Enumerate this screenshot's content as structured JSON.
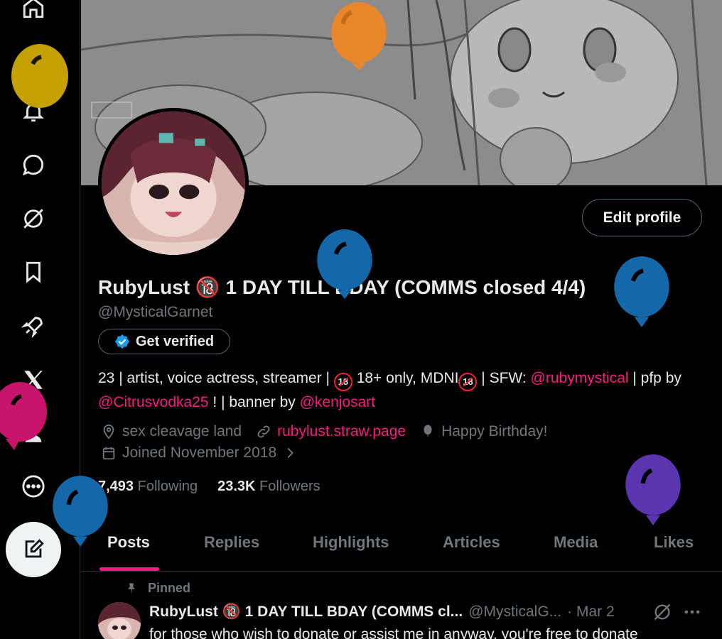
{
  "sidebar": {
    "items": [
      {
        "icon": "home-icon"
      },
      {
        "icon": "search-icon"
      },
      {
        "icon": "notifications-icon"
      },
      {
        "icon": "messages-icon"
      },
      {
        "icon": "grok-icon"
      },
      {
        "icon": "bookmarks-icon"
      },
      {
        "icon": "rocket-icon"
      },
      {
        "icon": "x-logo-icon"
      },
      {
        "icon": "profile-icon"
      },
      {
        "icon": "more-icon"
      }
    ],
    "compose_icon": "compose-icon"
  },
  "profile": {
    "display_name": "RubyLust 🔞 1 DAY TILL BDAY (COMMS closed 4/4)",
    "handle": "@MysticalGarnet",
    "edit_button": "Edit profile",
    "get_verified": "Get verified",
    "bio": {
      "part1": "23 | artist, voice actress, streamer | ",
      "part2": " 18+ only, MDNI",
      "part3": " | SFW: ",
      "mention1": "@rubymystical",
      "part4": " | pfp by ",
      "mention2": "@Citrusvodka25",
      "part5": " ! | banner by ",
      "mention3": "@kenjosart",
      "badge": "18"
    },
    "location": "sex cleavage land",
    "website": "rubylust.straw.page",
    "birthday": "Happy Birthday!",
    "joined": "Joined November 2018",
    "following_count": "7,493",
    "following_label": "Following",
    "followers_count": "23.3K",
    "followers_label": "Followers"
  },
  "tabs": [
    "Posts",
    "Replies",
    "Highlights",
    "Articles",
    "Media",
    "Likes"
  ],
  "pinned_post": {
    "pinned_label": "Pinned",
    "name": "RubyLust 🔞 1 DAY TILL BDAY (COMMS cl...",
    "handle": "@MysticalG...",
    "date": "· Mar 2",
    "text": "for those who wish to donate or assist me in anyway, you're free to donate"
  },
  "colors": {
    "accent": "#f91880",
    "verified": "#1d9bf0",
    "balloon_orange": "#e8862a",
    "balloon_blue": "#1467a8",
    "balloon_gold": "#c4a000",
    "balloon_magenta": "#c8156b",
    "balloon_purple": "#5b35b0"
  }
}
